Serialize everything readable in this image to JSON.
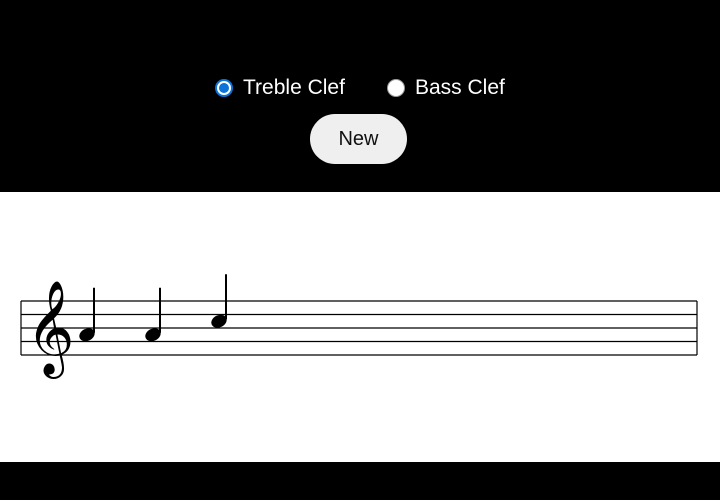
{
  "clef_selector": {
    "options": [
      {
        "label": "Treble Clef",
        "checked": true
      },
      {
        "label": "Bass Clef",
        "checked": false
      }
    ]
  },
  "controls": {
    "new_label": "New"
  },
  "staff": {
    "clef": "treble",
    "notes": [
      {
        "pitch": "A4",
        "duration": "quarter"
      },
      {
        "pitch": "A4",
        "duration": "quarter"
      },
      {
        "pitch": "C5",
        "duration": "quarter"
      }
    ]
  },
  "colors": {
    "background_dark": "#000000",
    "staff_background": "#ffffff",
    "radio_accent": "#0b73d9",
    "button_background": "#efefef"
  }
}
